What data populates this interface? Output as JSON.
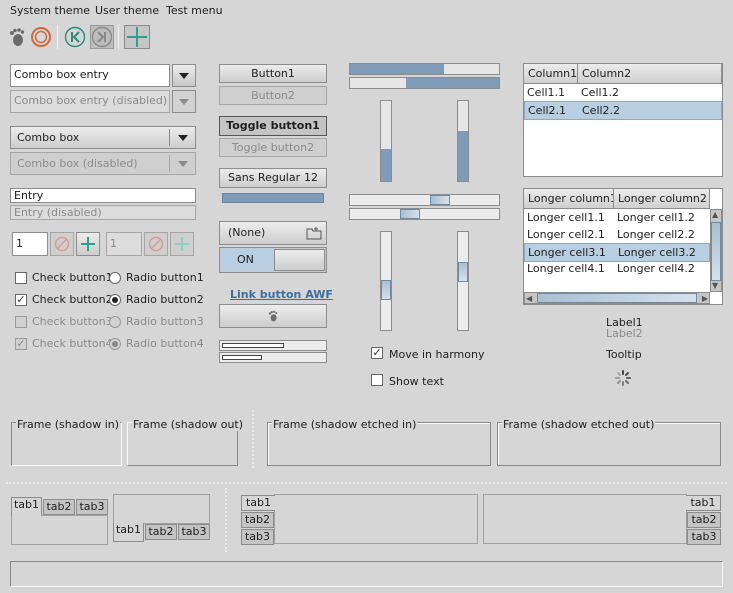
{
  "menubar": {
    "items": [
      "System theme",
      "User theme",
      "Test menu"
    ]
  },
  "toolbar": {
    "icons": [
      "gnome-foot-icon",
      "record-icon",
      "skip-back-icon",
      "skip-forward-icon",
      "plus-icon"
    ]
  },
  "col1": {
    "combo_entry": "Combo box entry",
    "combo_entry_disabled": "Combo box entry (disabled)",
    "combo_box": "Combo box",
    "combo_box_disabled": "Combo box (disabled)",
    "entry": "Entry",
    "entry_disabled": "Entry (disabled)",
    "spin1_value": "1",
    "spin2_value": "1",
    "check1": "Check button1",
    "check2": "Check button2",
    "check3": "Check button3",
    "check4": "Check button4",
    "radio1": "Radio button1",
    "radio2": "Radio button2",
    "radio3": "Radio button3",
    "radio4": "Radio button4"
  },
  "col2": {
    "button1": "Button1",
    "button2": "Button2",
    "toggle1": "Toggle button1",
    "toggle2": "Toggle button2",
    "font_name": "Sans Regular",
    "font_size": "12",
    "file_chooser": "(None)",
    "switch_on": "ON",
    "link": "Link button AWF"
  },
  "col3": {
    "move_in_harmony": "Move in harmony",
    "show_text": "Show text"
  },
  "table1": {
    "headers": [
      "Column1",
      "Column2"
    ],
    "rows": [
      [
        "Cell1.1",
        "Cell1.2"
      ],
      [
        "Cell2.1",
        "Cell2.2"
      ]
    ]
  },
  "table2": {
    "headers": [
      "Longer column1",
      "Longer column2"
    ],
    "rows": [
      [
        "Longer cell1.1",
        "Longer cell1.2"
      ],
      [
        "Longer cell2.1",
        "Longer cell2.2"
      ],
      [
        "Longer cell3.1",
        "Longer cell3.2"
      ],
      [
        "Longer cell4.1",
        "Longer cell4.2"
      ]
    ]
  },
  "labels": {
    "label1": "Label1",
    "label2": "Label2",
    "tooltip": "Tooltip"
  },
  "frames": {
    "in": "Frame (shadow in)",
    "out": "Frame (shadow out)",
    "etched_in": "Frame (shadow etched in)",
    "etched_out": "Frame (shadow etched out)"
  },
  "tabs": {
    "t1": "tab1",
    "t2": "tab2",
    "t3": "tab3"
  },
  "colors": {
    "accent": "#7f9bb7",
    "selection": "#b9cee0",
    "link": "#3c6e9e",
    "plus": "#2aa38c"
  }
}
